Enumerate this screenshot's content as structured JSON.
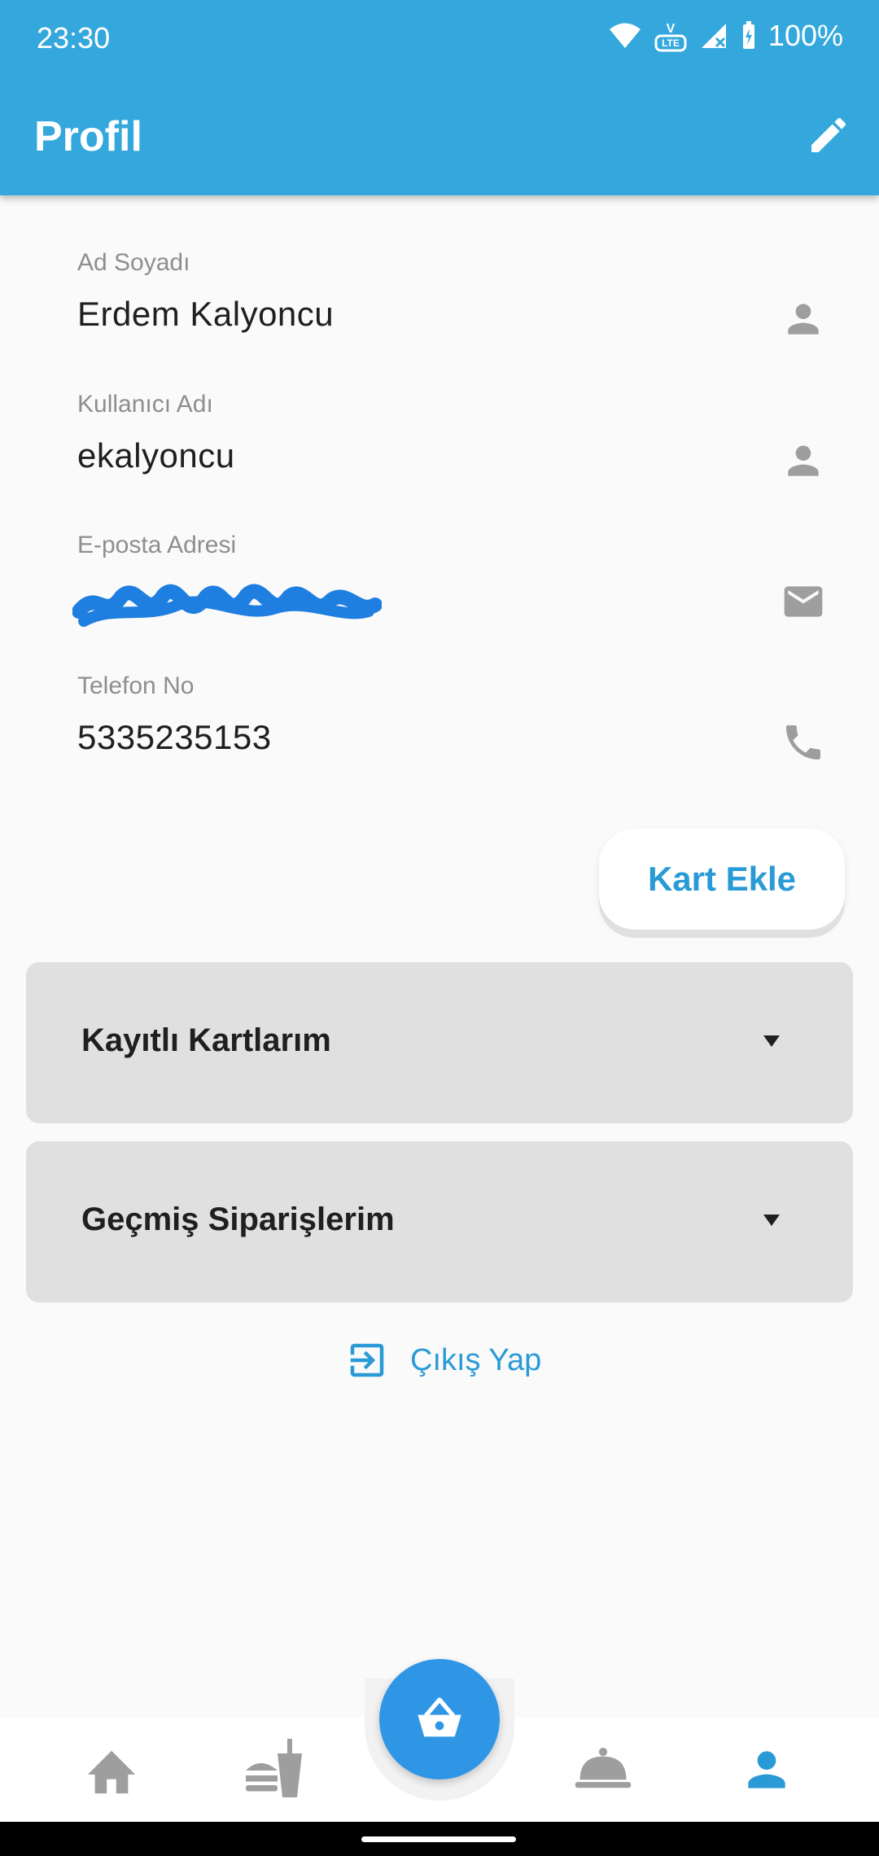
{
  "status_bar": {
    "time": "23:30",
    "battery": "100%",
    "lte_label": "LTE"
  },
  "app_bar": {
    "title": "Profil"
  },
  "fields": [
    {
      "label": "Ad Soyadı",
      "value": "Erdem Kalyoncu",
      "icon": "person-icon"
    },
    {
      "label": "Kullanıcı Adı",
      "value": "ekalyoncu",
      "icon": "person-icon"
    },
    {
      "label": "E-posta Adresi",
      "value": "",
      "icon": "mail-icon"
    },
    {
      "label": "Telefon No",
      "value": "5335235153",
      "icon": "phone-icon"
    }
  ],
  "kart_ekle_label": "Kart Ekle",
  "panels": [
    {
      "title": "Kayıtlı Kartlarım"
    },
    {
      "title": "Geçmiş Siparişlerim"
    }
  ],
  "logout_label": "Çıkış Yap",
  "nav": {
    "items": [
      "home-icon",
      "food-icon",
      "basket-icon",
      "dish-icon",
      "profile-icon"
    ],
    "active": "profile-icon"
  },
  "colors": {
    "primary": "#34a8dc",
    "accent": "#2a9ad6",
    "fab": "#2f96e6",
    "panel": "#e0e0e0",
    "icon_gray": "#9e9e9e"
  }
}
